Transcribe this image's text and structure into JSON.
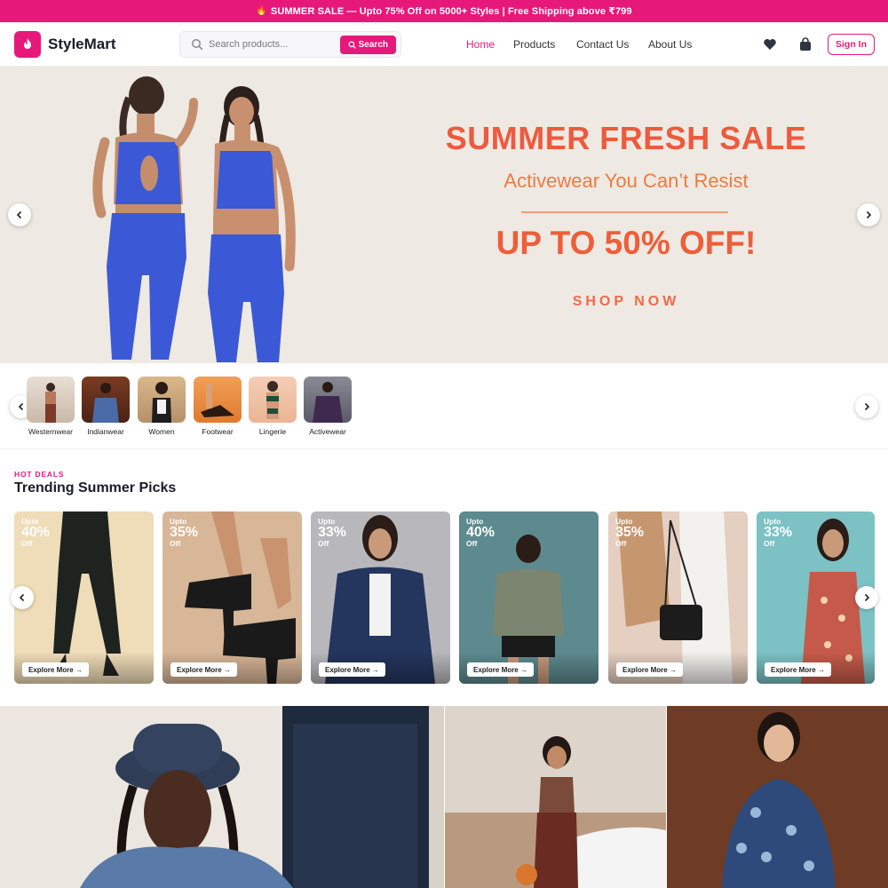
{
  "announcement": {
    "icon": "fire-icon",
    "text": "SUMMER SALE — Upto 75% Off on 5000+ Styles | Free Shipping above ₹799"
  },
  "header": {
    "brand": "StyleMart",
    "search": {
      "placeholder": "Search products...",
      "button_label": "Search"
    },
    "nav": [
      {
        "label": "Home",
        "active": true
      },
      {
        "label": "Products",
        "active": false
      },
      {
        "label": "Contact Us",
        "active": false
      },
      {
        "label": "About Us",
        "active": false
      }
    ],
    "icons": [
      "heart-icon",
      "shopping-bag-icon"
    ],
    "signin_label": "Sign In"
  },
  "hero": {
    "title": "SUMMER FRESH SALE",
    "subtitle": "Activewear You Can’t Resist",
    "offer": "UP TO 50% OFF!",
    "cta": "SHOP NOW"
  },
  "categories": [
    {
      "label": "Westernwear"
    },
    {
      "label": "Indianwear"
    },
    {
      "label": "Women"
    },
    {
      "label": "Footwear"
    },
    {
      "label": "Lingerie"
    },
    {
      "label": "Activewear"
    }
  ],
  "deals": {
    "kicker": "HOT DEALS",
    "title": "Trending Summer Picks",
    "items": [
      {
        "upto": "Upto",
        "percent": "40%",
        "off": "Off",
        "button": "Explore More →"
      },
      {
        "upto": "Upto",
        "percent": "35%",
        "off": "Off",
        "button": "Explore More →"
      },
      {
        "upto": "Upto",
        "percent": "33%",
        "off": "Off",
        "button": "Explore More →"
      },
      {
        "upto": "Upto",
        "percent": "40%",
        "off": "Off",
        "button": "Explore More →"
      },
      {
        "upto": "Upto",
        "percent": "35%",
        "off": "Off",
        "button": "Explore More →"
      },
      {
        "upto": "Upto",
        "percent": "33%",
        "off": "Off",
        "button": "Explore More →"
      }
    ]
  },
  "colors": {
    "brand": "#e6197a",
    "hero_text": "#ed5a3d",
    "hero_bg": "#eee9e2"
  }
}
